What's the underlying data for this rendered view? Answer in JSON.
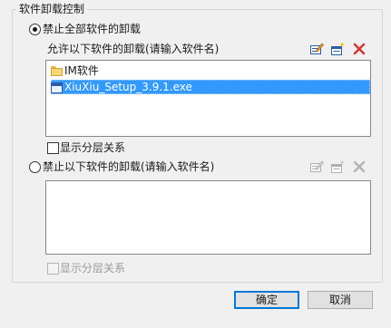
{
  "group": {
    "title": "软件卸载控制"
  },
  "option_block_all": {
    "label": "禁止全部软件的卸载",
    "checked": true
  },
  "allow_section": {
    "label": "允许以下软件的卸载(请输入软件名)",
    "items": [
      {
        "text": "IM软件",
        "icon": "folder-icon",
        "selected": false
      },
      {
        "text": "XiuXiu_Setup_3.9.1.exe",
        "icon": "exe-icon",
        "selected": true
      }
    ],
    "show_hierarchy": {
      "label": "显示分层关系",
      "checked": false
    }
  },
  "option_block_listed": {
    "label": "禁止以下软件的卸载(请输入软件名)",
    "checked": false
  },
  "block_section": {
    "items": [],
    "show_hierarchy": {
      "label": "显示分层关系",
      "checked": false,
      "disabled": true
    }
  },
  "toolbar_icons": [
    "edit-icon",
    "add-icon",
    "delete-icon"
  ],
  "buttons": {
    "ok": "确定",
    "cancel": "取消"
  },
  "colors": {
    "selection": "#3399ff",
    "delete": "#d03a2f",
    "focus": "#0078d7"
  }
}
